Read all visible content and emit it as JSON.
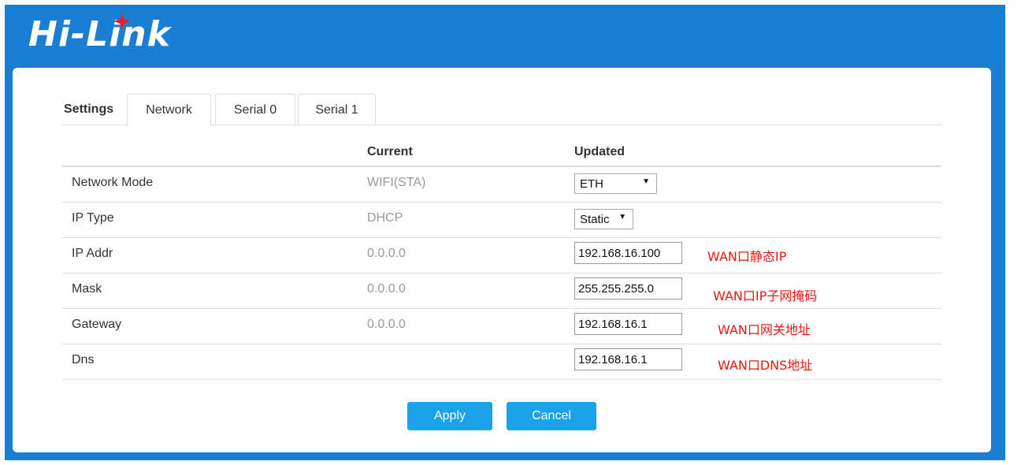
{
  "brand": {
    "logo_text": "Hi-Link"
  },
  "tabs": {
    "section_label": "Settings",
    "items": [
      {
        "label": "Network",
        "active": true
      },
      {
        "label": "Serial 0",
        "active": false
      },
      {
        "label": "Serial 1",
        "active": false
      }
    ]
  },
  "table": {
    "headers": {
      "current": "Current",
      "updated": "Updated"
    },
    "rows": [
      {
        "label": "Network Mode",
        "current": "WIFI(STA)",
        "control": "select",
        "value": "ETH",
        "note": ""
      },
      {
        "label": "IP Type",
        "current": "DHCP",
        "control": "select",
        "value": "Static",
        "note": ""
      },
      {
        "label": "IP Addr",
        "current": "0.0.0.0",
        "control": "input",
        "value": "192.168.16.100",
        "note": "WAN口静态IP"
      },
      {
        "label": "Mask",
        "current": "0.0.0.0",
        "control": "input",
        "value": "255.255.255.0",
        "note": "WAN口IP子网掩码"
      },
      {
        "label": "Gateway",
        "current": "0.0.0.0",
        "control": "input",
        "value": "192.168.16.1",
        "note": "WAN口网关地址"
      },
      {
        "label": "Dns",
        "current": "",
        "control": "input",
        "value": "192.168.16.1",
        "note": "WAN口DNS地址"
      }
    ]
  },
  "actions": {
    "apply_label": "Apply",
    "cancel_label": "Cancel"
  },
  "colors": {
    "brand_blue": "#1a7fd4",
    "button_blue": "#1aa3e8",
    "annotation_red": "#e8190f",
    "logo_star": "#e8202a"
  }
}
